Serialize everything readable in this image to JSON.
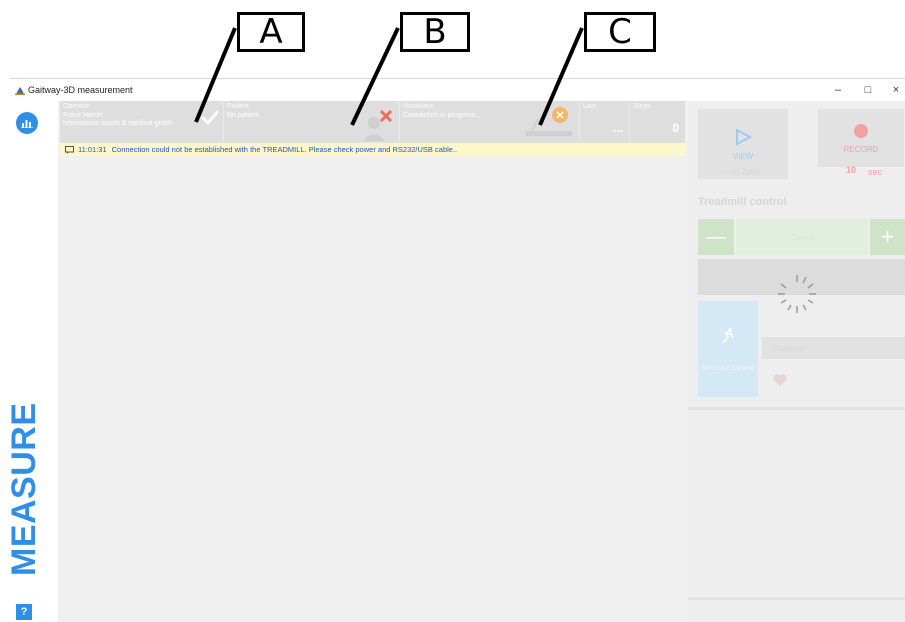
{
  "callouts": [
    "A",
    "B",
    "C"
  ],
  "window": {
    "title": "Gaitway-3D measurement",
    "minimize": "–",
    "maximize": "□",
    "close": "×"
  },
  "sidebar": {
    "mode_label": "MEASURE",
    "help": "?"
  },
  "status": {
    "operator": {
      "label": "Operator",
      "name": "Franz Harrer",
      "org": "h/p/cosmos sports & medical gmbh"
    },
    "patient": {
      "label": "Patient",
      "value": "No patient"
    },
    "hardware": {
      "label": "Hardware",
      "value": "Connection in progress..."
    },
    "last": {
      "label": "Last",
      "value": "..."
    },
    "steps": {
      "label": "Steps",
      "value": "0"
    }
  },
  "message": {
    "time": "11:01:31",
    "text": "Connection could not be established with the TREADMILL. Please check power and RS232/USB cable.."
  },
  "right_panel": {
    "view": "VIEW",
    "record": "RECORD",
    "zero": "-=8 Zero",
    "record_seconds": "10",
    "record_unit": "sec",
    "treadmill_title": "Treadmill control",
    "speed": "Speed",
    "minus": "—",
    "plus": "+",
    "distance": "Distance",
    "measure_control": "Measure Control"
  },
  "colors": {
    "accent": "#2f8ee6",
    "message_bg": "#fff7cc",
    "message_text": "#1a56c4",
    "status_bg": "#dedede"
  }
}
